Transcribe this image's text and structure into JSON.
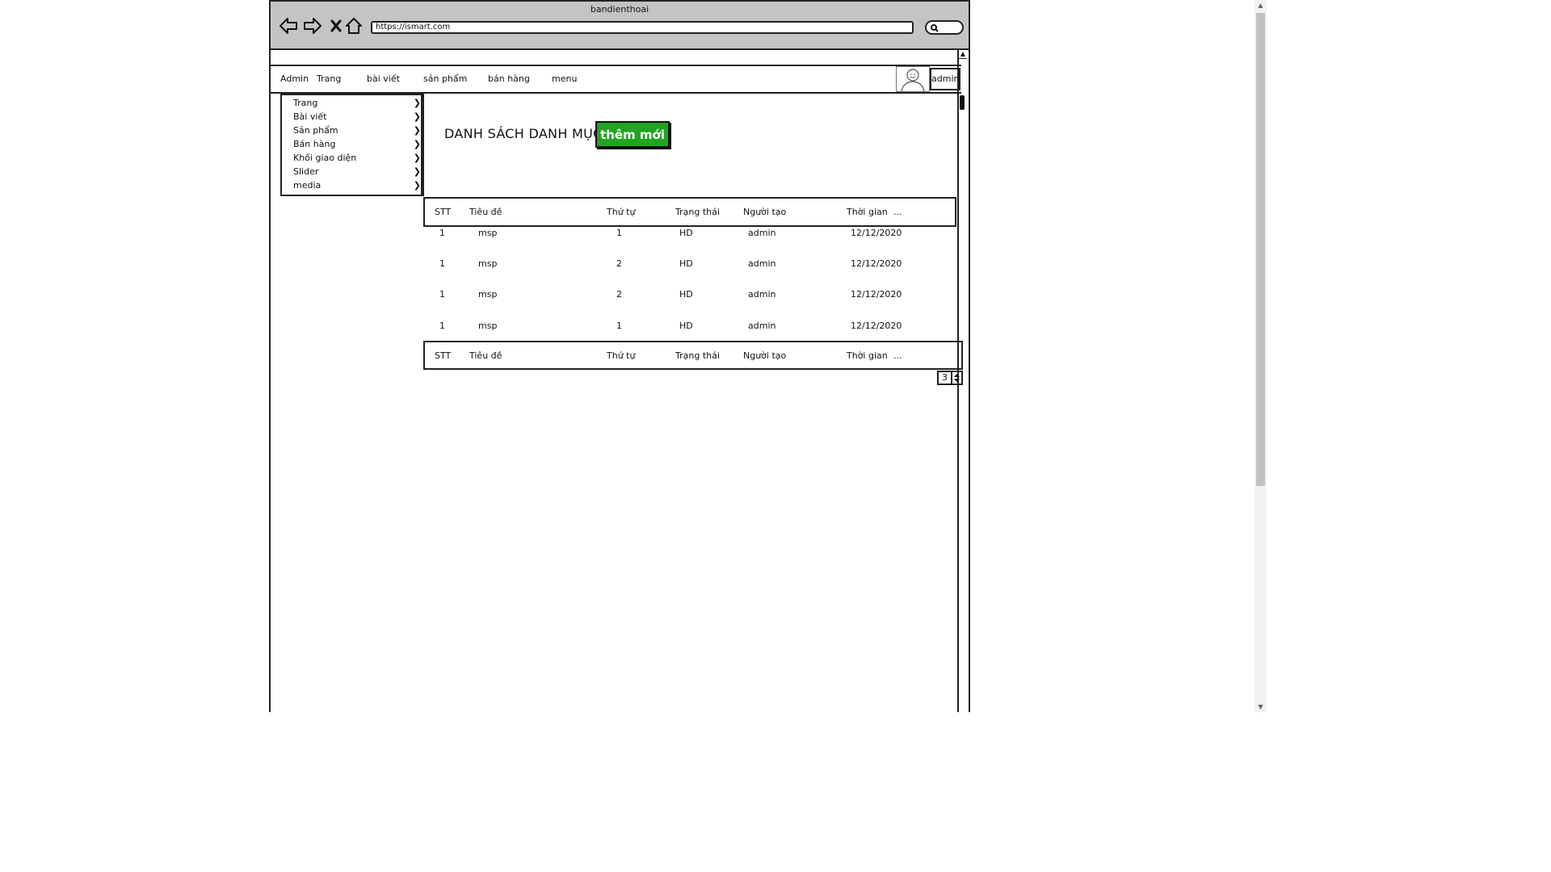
{
  "window": {
    "title": "bandienthoai"
  },
  "browser": {
    "url": "https://ismart.com"
  },
  "menubar": {
    "items": [
      "Admin",
      "Trang",
      "bài viết",
      "sản phẩm",
      "bán hàng",
      "menu"
    ],
    "user": "admin"
  },
  "dropdown": {
    "items": [
      "Trang",
      "Bài viết",
      "Sản phẩm",
      "Bán hàng",
      "Khối giao diện",
      "Slider",
      "media"
    ]
  },
  "page": {
    "title": "DANH SÁCH DANH MỤC",
    "add_label": "thêm mới"
  },
  "table": {
    "headers": [
      "STT",
      "Tiêu đề",
      "Thứ tự",
      "Trạng thái",
      "Người tạo",
      "Thời gian",
      "..."
    ],
    "rows": [
      [
        "1",
        "msp",
        "1",
        "HD",
        "admin",
        "12/12/2020"
      ],
      [
        "1",
        "msp",
        "2",
        "HD",
        "admin",
        "12/12/2020"
      ],
      [
        "1",
        "msp",
        "2",
        "HD",
        "admin",
        "12/12/2020"
      ],
      [
        "1",
        "msp",
        "1",
        "HD",
        "admin",
        "12/12/2020"
      ]
    ]
  },
  "pager": {
    "value": "3"
  }
}
